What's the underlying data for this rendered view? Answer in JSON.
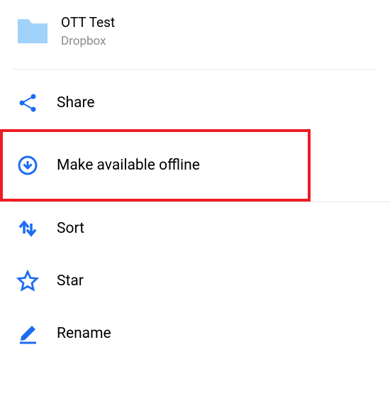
{
  "header": {
    "title": "OTT Test",
    "subtitle": "Dropbox"
  },
  "menu": {
    "share": "Share",
    "offline": "Make available offline",
    "sort": "Sort",
    "star": "Star",
    "rename": "Rename"
  },
  "colors": {
    "accent": "#1c6cf2",
    "folder": "#a1d2fa",
    "highlight": "#ec1c24"
  }
}
